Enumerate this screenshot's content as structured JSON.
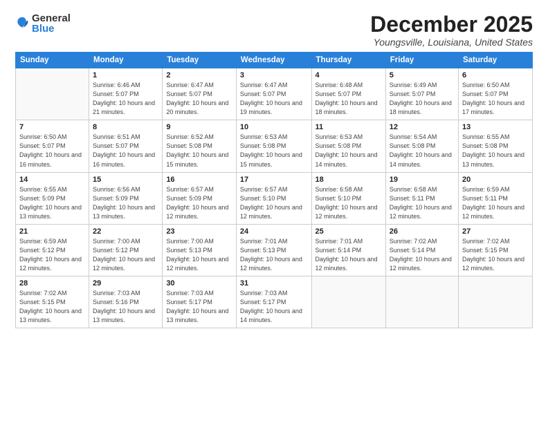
{
  "logo": {
    "text_general": "General",
    "text_blue": "Blue"
  },
  "title": "December 2025",
  "location": "Youngsville, Louisiana, United States",
  "days_of_week": [
    "Sunday",
    "Monday",
    "Tuesday",
    "Wednesday",
    "Thursday",
    "Friday",
    "Saturday"
  ],
  "weeks": [
    [
      {
        "day": "",
        "empty": true
      },
      {
        "day": "1",
        "sunrise": "6:46 AM",
        "sunset": "5:07 PM",
        "daylight": "10 hours and 21 minutes."
      },
      {
        "day": "2",
        "sunrise": "6:47 AM",
        "sunset": "5:07 PM",
        "daylight": "10 hours and 20 minutes."
      },
      {
        "day": "3",
        "sunrise": "6:47 AM",
        "sunset": "5:07 PM",
        "daylight": "10 hours and 19 minutes."
      },
      {
        "day": "4",
        "sunrise": "6:48 AM",
        "sunset": "5:07 PM",
        "daylight": "10 hours and 18 minutes."
      },
      {
        "day": "5",
        "sunrise": "6:49 AM",
        "sunset": "5:07 PM",
        "daylight": "10 hours and 18 minutes."
      },
      {
        "day": "6",
        "sunrise": "6:50 AM",
        "sunset": "5:07 PM",
        "daylight": "10 hours and 17 minutes."
      }
    ],
    [
      {
        "day": "7",
        "sunrise": "6:50 AM",
        "sunset": "5:07 PM",
        "daylight": "10 hours and 16 minutes."
      },
      {
        "day": "8",
        "sunrise": "6:51 AM",
        "sunset": "5:07 PM",
        "daylight": "10 hours and 16 minutes."
      },
      {
        "day": "9",
        "sunrise": "6:52 AM",
        "sunset": "5:08 PM",
        "daylight": "10 hours and 15 minutes."
      },
      {
        "day": "10",
        "sunrise": "6:53 AM",
        "sunset": "5:08 PM",
        "daylight": "10 hours and 15 minutes."
      },
      {
        "day": "11",
        "sunrise": "6:53 AM",
        "sunset": "5:08 PM",
        "daylight": "10 hours and 14 minutes."
      },
      {
        "day": "12",
        "sunrise": "6:54 AM",
        "sunset": "5:08 PM",
        "daylight": "10 hours and 14 minutes."
      },
      {
        "day": "13",
        "sunrise": "6:55 AM",
        "sunset": "5:08 PM",
        "daylight": "10 hours and 13 minutes."
      }
    ],
    [
      {
        "day": "14",
        "sunrise": "6:55 AM",
        "sunset": "5:09 PM",
        "daylight": "10 hours and 13 minutes."
      },
      {
        "day": "15",
        "sunrise": "6:56 AM",
        "sunset": "5:09 PM",
        "daylight": "10 hours and 13 minutes."
      },
      {
        "day": "16",
        "sunrise": "6:57 AM",
        "sunset": "5:09 PM",
        "daylight": "10 hours and 12 minutes."
      },
      {
        "day": "17",
        "sunrise": "6:57 AM",
        "sunset": "5:10 PM",
        "daylight": "10 hours and 12 minutes."
      },
      {
        "day": "18",
        "sunrise": "6:58 AM",
        "sunset": "5:10 PM",
        "daylight": "10 hours and 12 minutes."
      },
      {
        "day": "19",
        "sunrise": "6:58 AM",
        "sunset": "5:11 PM",
        "daylight": "10 hours and 12 minutes."
      },
      {
        "day": "20",
        "sunrise": "6:59 AM",
        "sunset": "5:11 PM",
        "daylight": "10 hours and 12 minutes."
      }
    ],
    [
      {
        "day": "21",
        "sunrise": "6:59 AM",
        "sunset": "5:12 PM",
        "daylight": "10 hours and 12 minutes."
      },
      {
        "day": "22",
        "sunrise": "7:00 AM",
        "sunset": "5:12 PM",
        "daylight": "10 hours and 12 minutes."
      },
      {
        "day": "23",
        "sunrise": "7:00 AM",
        "sunset": "5:13 PM",
        "daylight": "10 hours and 12 minutes."
      },
      {
        "day": "24",
        "sunrise": "7:01 AM",
        "sunset": "5:13 PM",
        "daylight": "10 hours and 12 minutes."
      },
      {
        "day": "25",
        "sunrise": "7:01 AM",
        "sunset": "5:14 PM",
        "daylight": "10 hours and 12 minutes."
      },
      {
        "day": "26",
        "sunrise": "7:02 AM",
        "sunset": "5:14 PM",
        "daylight": "10 hours and 12 minutes."
      },
      {
        "day": "27",
        "sunrise": "7:02 AM",
        "sunset": "5:15 PM",
        "daylight": "10 hours and 12 minutes."
      }
    ],
    [
      {
        "day": "28",
        "sunrise": "7:02 AM",
        "sunset": "5:15 PM",
        "daylight": "10 hours and 13 minutes."
      },
      {
        "day": "29",
        "sunrise": "7:03 AM",
        "sunset": "5:16 PM",
        "daylight": "10 hours and 13 minutes."
      },
      {
        "day": "30",
        "sunrise": "7:03 AM",
        "sunset": "5:17 PM",
        "daylight": "10 hours and 13 minutes."
      },
      {
        "day": "31",
        "sunrise": "7:03 AM",
        "sunset": "5:17 PM",
        "daylight": "10 hours and 14 minutes."
      },
      {
        "day": "",
        "empty": true
      },
      {
        "day": "",
        "empty": true
      },
      {
        "day": "",
        "empty": true
      }
    ]
  ]
}
